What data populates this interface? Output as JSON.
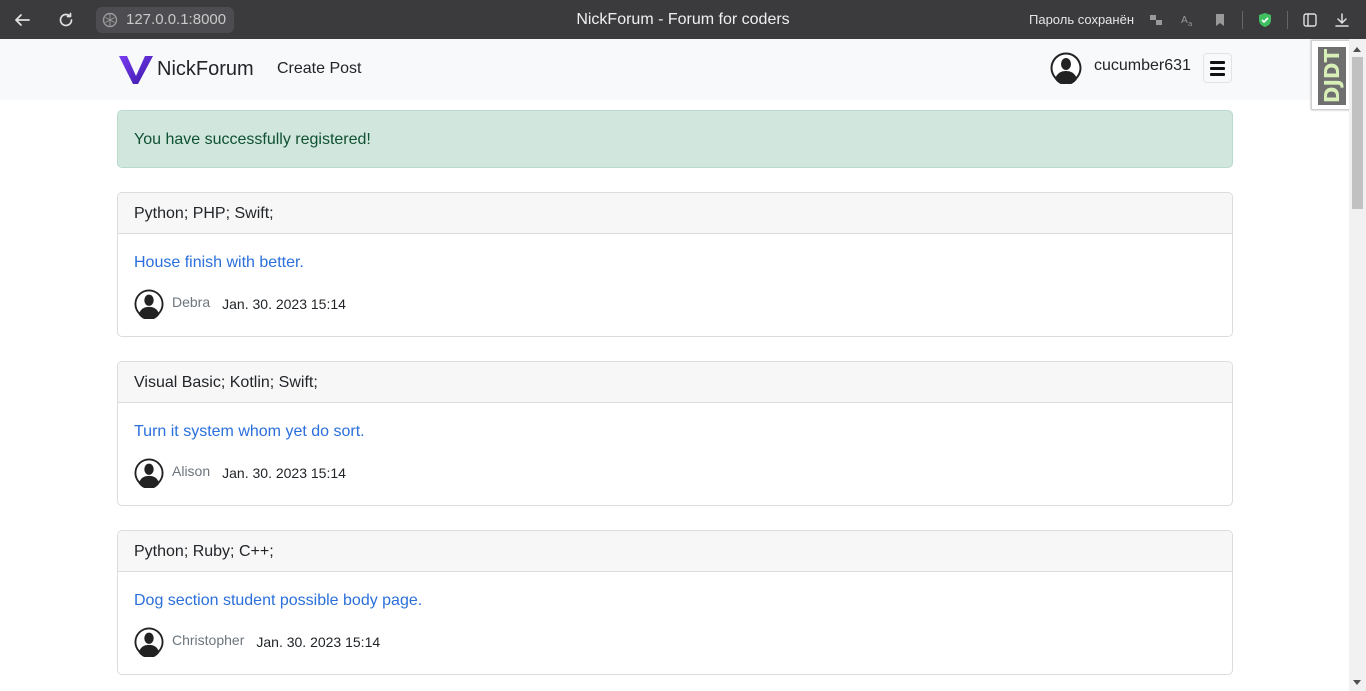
{
  "browser": {
    "url": "127.0.0.1:8000",
    "title": "NickForum - Forum for coders",
    "password_saved": "Пароль сохранён"
  },
  "navbar": {
    "brand": "NickForum",
    "create_post": "Create Post",
    "username": "cucumber631"
  },
  "djdt": {
    "label": "DJDT"
  },
  "alert": {
    "message": "You have successfully registered!"
  },
  "posts": [
    {
      "tags": "Python; PHP; Swift;",
      "title": "House finish with better.",
      "author": "Debra",
      "date": "Jan. 30. 2023 15:14"
    },
    {
      "tags": "Visual Basic; Kotlin; Swift;",
      "title": "Turn it system whom yet do sort.",
      "author": "Alison",
      "date": "Jan. 30. 2023 15:14"
    },
    {
      "tags": "Python; Ruby; C++;",
      "title": "Dog section student possible body page.",
      "author": "Christopher",
      "date": "Jan. 30. 2023 15:14"
    }
  ],
  "colors": {
    "link": "#2a6fdb",
    "alert_bg": "#d1e7dd",
    "alert_text": "#0f5132",
    "navbar_bg": "#f8f9fa",
    "brand_logo": "#5b2bd8"
  }
}
